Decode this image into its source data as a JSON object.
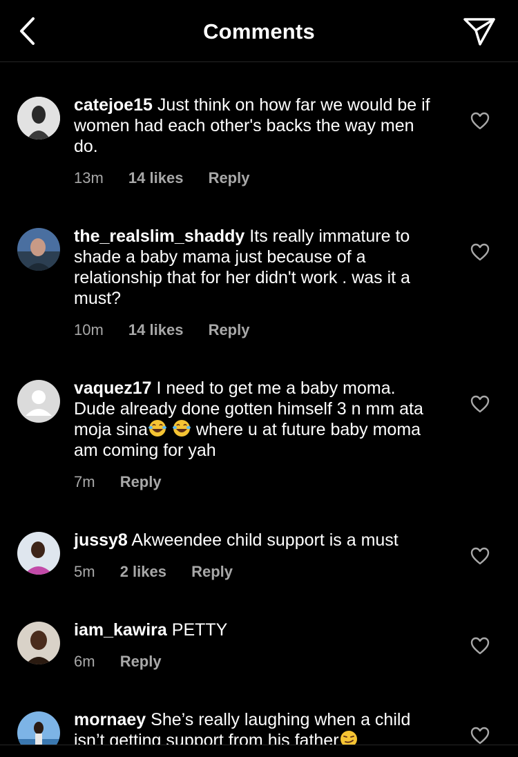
{
  "header": {
    "title": "Comments"
  },
  "comments": [
    {
      "username": "catejoe15",
      "text": "Just think on how far we would be if women had each other's backs the way men do.",
      "time": "13m",
      "likes": "14 likes",
      "reply": "Reply"
    },
    {
      "username": "the_realslim_shaddy",
      "text": "Its really immature to shade a baby mama just because of a relationship that for her didn't work . was it a must?",
      "time": "10m",
      "likes": "14 likes",
      "reply": "Reply"
    },
    {
      "username": "vaquez17",
      "text_before": "I need to get me a baby moma. Dude already done gotten himself 3 n mm ata moja sina",
      "text_after": " where u at future baby moma am coming for yah",
      "time": "7m",
      "reply": "Reply"
    },
    {
      "username": "jussy8",
      "text": "Akweendee child support is a must",
      "time": "5m",
      "likes": "2 likes",
      "reply": "Reply"
    },
    {
      "username": "iam_kawira",
      "text": "PETTY",
      "time": "6m",
      "reply": "Reply"
    },
    {
      "username": "mornaey",
      "text": "She’s really laughing when a child isn’t getting support from his father"
    }
  ]
}
